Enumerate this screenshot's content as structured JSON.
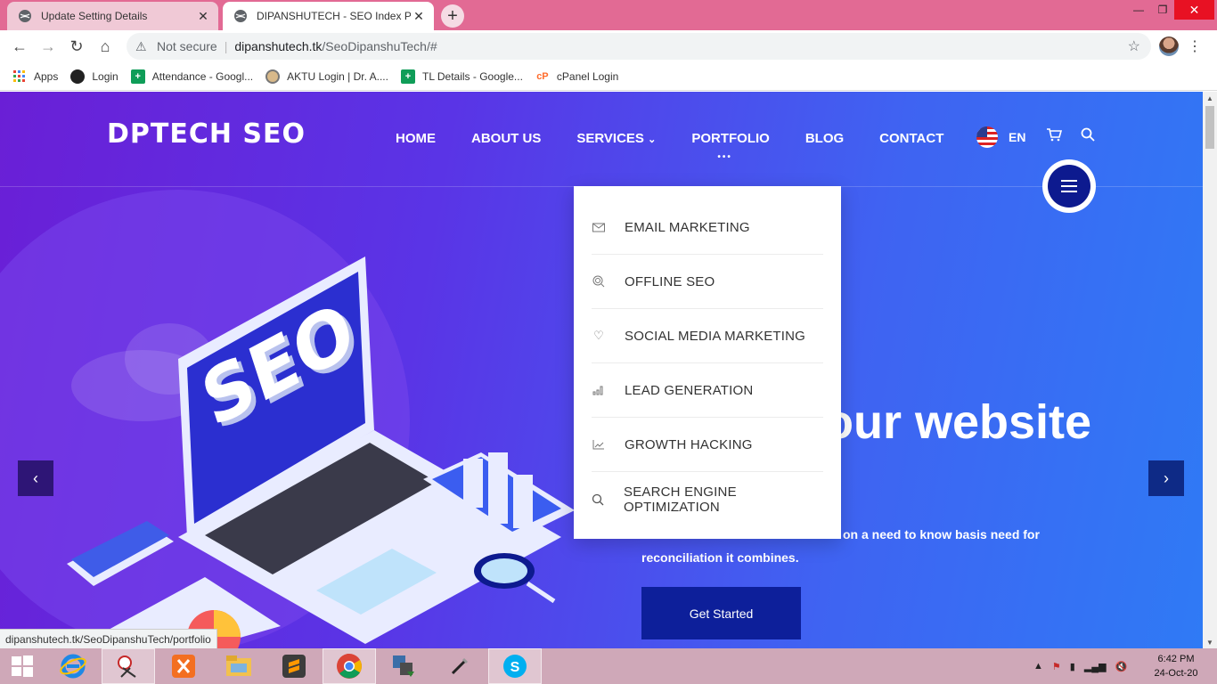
{
  "browser": {
    "tabs": [
      {
        "title": "Update Setting Details",
        "close": "✕"
      },
      {
        "title": "DIPANSHUTECH - SEO Index Pag",
        "close": "✕"
      }
    ],
    "new_tab": "+",
    "window_controls": {
      "minimize": "—",
      "maximize": "❐",
      "close": "✕"
    },
    "address": {
      "security": "Not secure",
      "host": "dipanshutech.tk",
      "path": "/SeoDipanshuTech/#"
    },
    "bookmarks": [
      {
        "label": "Apps",
        "icon": "apps-grid-icon"
      },
      {
        "label": "Login",
        "icon": "globe-icon"
      },
      {
        "label": "Attendance - Googl...",
        "icon": "google-sheets-icon"
      },
      {
        "label": "AKTU Login | Dr. A....",
        "icon": "aktu-icon"
      },
      {
        "label": "TL Details - Google...",
        "icon": "google-sheets-icon"
      },
      {
        "label": "cPanel Login",
        "icon": "cpanel-icon"
      }
    ],
    "status_url": "dipanshutech.tk/SeoDipanshuTech/portfolio"
  },
  "site": {
    "logo": "DPTECH SEO",
    "nav": [
      "HOME",
      "ABOUT US",
      "SERVICES",
      "PORTFOLIO",
      "BLOG",
      "CONTACT"
    ],
    "services_caret": "⌄",
    "portfolio_dots": "•••",
    "language": "EN",
    "dropdown": [
      {
        "label": "EMAIL MARKETING",
        "icon": "envelope-icon"
      },
      {
        "label": "OFFLINE SEO",
        "icon": "target-icon"
      },
      {
        "label": "SOCIAL MEDIA MARKETING",
        "icon": "heart-icon"
      },
      {
        "label": "LEAD GENERATION",
        "icon": "bar-chart-icon"
      },
      {
        "label": "GROWTH HACKING",
        "icon": "trend-chart-icon"
      },
      {
        "label": "SEARCH ENGINE OPTIMIZATION",
        "icon": "search-icon"
      }
    ],
    "hero_title_visible": "our website",
    "hero_text_line1": "on a need to know basis need for",
    "hero_text_line2": "reconciliation it combines.",
    "cta": "Get Started",
    "illustration_text": "SEO"
  },
  "taskbar": {
    "time": "6:42 PM",
    "date": "24-Oct-20"
  },
  "colors": {
    "hero_gradient_start": "#6a1fd6",
    "hero_gradient_end": "#2f7af5",
    "cta_bg": "#0d1f9a",
    "tab_strip": "#e26a94"
  }
}
